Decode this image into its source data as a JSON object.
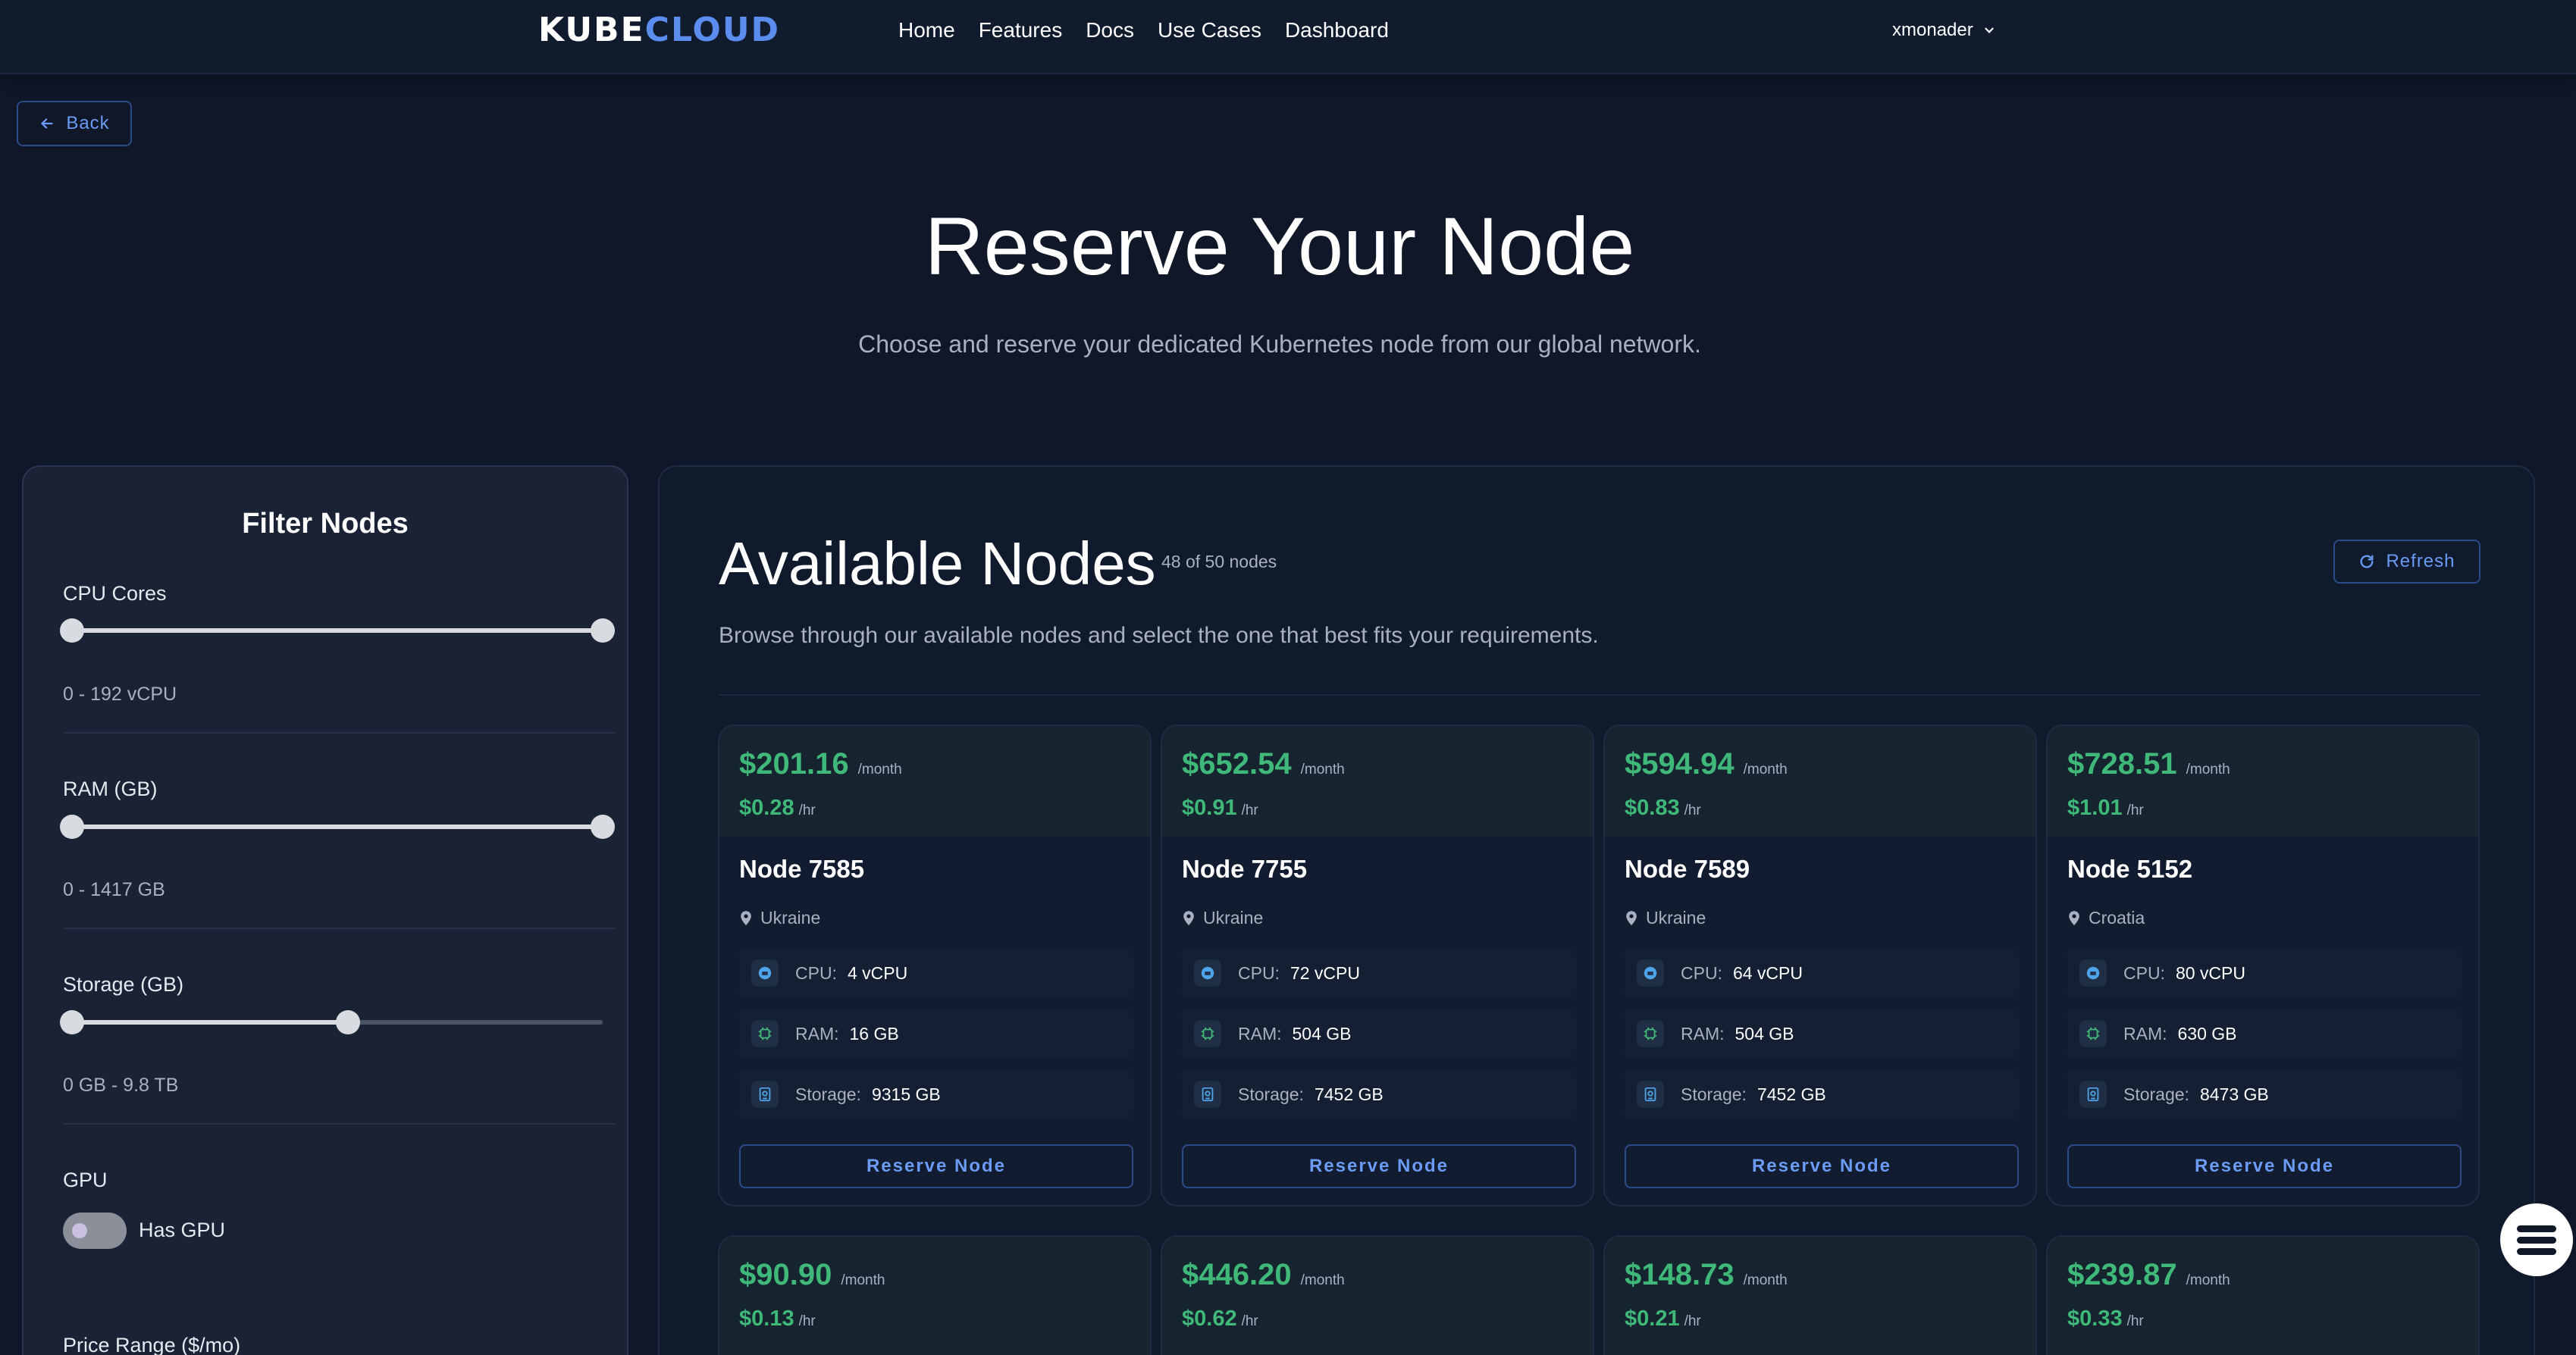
{
  "nav": {
    "logo_left": "KUBE",
    "logo_right": "CLOUD",
    "links": [
      "Home",
      "Features",
      "Docs",
      "Use Cases",
      "Dashboard"
    ],
    "user": "xmonader"
  },
  "back_label": "Back",
  "hero": {
    "title": "Reserve Your Node",
    "subtitle": "Choose and reserve your dedicated Kubernetes node from our global network."
  },
  "filters": {
    "title": "Filter Nodes",
    "cpu": {
      "label": "CPU Cores",
      "range_text": "0 - 192 vCPU",
      "min_frac": 0.0,
      "max_frac": 1.0
    },
    "ram": {
      "label": "RAM (GB)",
      "range_text": "0 - 1417 GB",
      "min_frac": 0.0,
      "max_frac": 1.0
    },
    "storage": {
      "label": "Storage (GB)",
      "range_text": "0 GB - 9.8 TB",
      "min_frac": 0.0,
      "max_frac": 0.52
    },
    "gpu": {
      "label": "GPU",
      "toggle_label": "Has GPU",
      "enabled": false
    },
    "price": {
      "label": "Price Range ($/mo)"
    }
  },
  "nodes_panel": {
    "title": "Available Nodes",
    "count": "48 of 50 nodes",
    "refresh_label": "Refresh",
    "subtitle": "Browse through our available nodes and select the one that best fits your requirements."
  },
  "labels": {
    "per_month": "/month",
    "per_hour": "/hr",
    "cpu": "CPU:",
    "ram": "RAM:",
    "storage": "Storage:",
    "reserve": "Reserve Node"
  },
  "nodes": [
    {
      "month": "$201.16",
      "hour": "$0.28",
      "name": "Node 7585",
      "location": "Ukraine",
      "cpu": "4 vCPU",
      "ram": "16 GB",
      "storage": "9315 GB"
    },
    {
      "month": "$652.54",
      "hour": "$0.91",
      "name": "Node 7755",
      "location": "Ukraine",
      "cpu": "72 vCPU",
      "ram": "504 GB",
      "storage": "7452 GB"
    },
    {
      "month": "$594.94",
      "hour": "$0.83",
      "name": "Node 7589",
      "location": "Ukraine",
      "cpu": "64 vCPU",
      "ram": "504 GB",
      "storage": "7452 GB"
    },
    {
      "month": "$728.51",
      "hour": "$1.01",
      "name": "Node 5152",
      "location": "Croatia",
      "cpu": "80 vCPU",
      "ram": "630 GB",
      "storage": "8473 GB"
    },
    {
      "month": "$90.90",
      "hour": "$0.13"
    },
    {
      "month": "$446.20",
      "hour": "$0.62"
    },
    {
      "month": "$148.73",
      "hour": "$0.21"
    },
    {
      "month": "$239.87",
      "hour": "$0.33"
    }
  ],
  "colors": {
    "accent": "#5b8def",
    "price_green": "#3fb87a",
    "background": "#0f1729"
  }
}
